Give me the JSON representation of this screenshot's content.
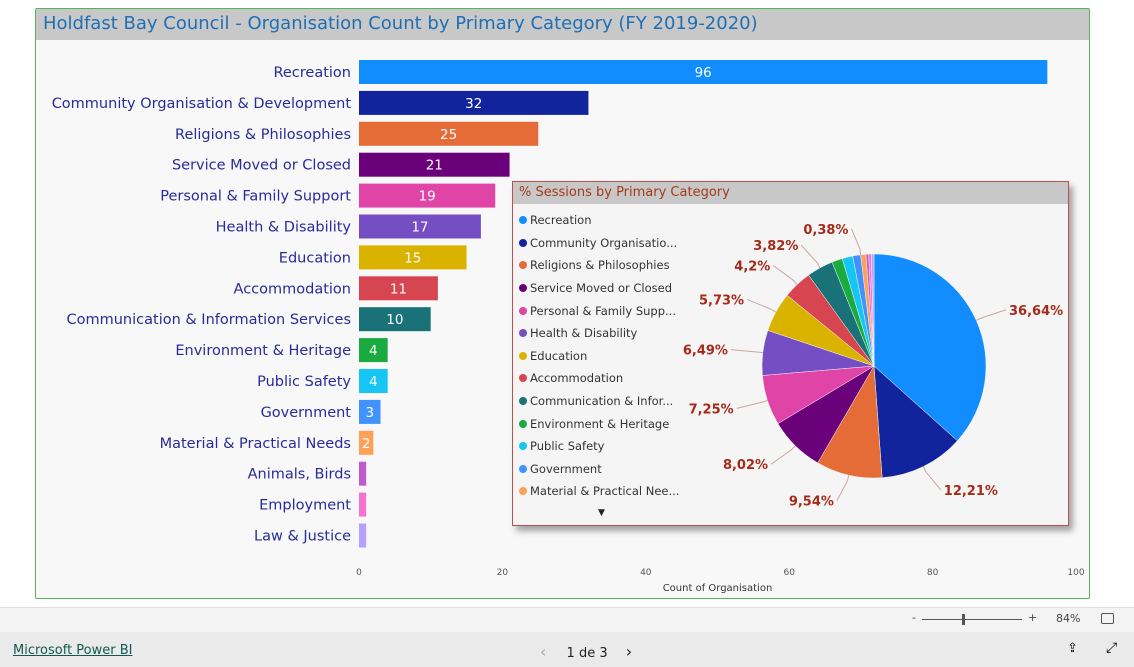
{
  "title": "Holdfast Bay Council - Organisation Count by Primary Category (FY 2019-2020)",
  "bar_chart": {
    "type": "bar",
    "orientation": "horizontal",
    "categories": [
      "Recreation",
      "Community Organisation & Development",
      "Religions & Philosophies",
      "Service Moved or Closed",
      "Personal & Family Support",
      "Health & Disability",
      "Education",
      "Accommodation",
      "Communication & Information Services",
      "Environment & Heritage",
      "Public Safety",
      "Government",
      "Material & Practical Needs",
      "Animals, Birds",
      "Employment",
      "Law & Justice"
    ],
    "values": [
      96,
      32,
      25,
      21,
      19,
      17,
      15,
      11,
      10,
      4,
      4,
      3,
      2,
      1,
      1,
      1
    ],
    "data_labels": [
      "96",
      "32",
      "25",
      "21",
      "19",
      "17",
      "15",
      "11",
      "10",
      "4",
      "4",
      "3",
      "2",
      "",
      "",
      ""
    ],
    "colors": [
      "#118DFF",
      "#12239E",
      "#E66C37",
      "#6B007B",
      "#E044A7",
      "#744EC2",
      "#D9B300",
      "#D64550",
      "#197278",
      "#1AAB40",
      "#15C6F4",
      "#4092FF",
      "#FFA058",
      "#BE5DC9",
      "#F472D0",
      "#B5A1FF"
    ],
    "xlabel": "Count of Organisation",
    "xlim": [
      0,
      100
    ],
    "xticks": [
      "0",
      "20",
      "40",
      "60",
      "80",
      "100"
    ],
    "grid": false
  },
  "chart_data": {
    "type": "pie",
    "title": "% Sessions by Primary Category",
    "categories": [
      "Recreation",
      "Community Organisation & Development",
      "Religions & Philosophies",
      "Service Moved or Closed",
      "Personal & Family Support",
      "Health & Disability",
      "Education",
      "Accommodation",
      "Communication & Information Services",
      "Environment & Heritage",
      "Public Safety",
      "Government",
      "Material & Practical Needs",
      "Animals, Birds",
      "Employment",
      "Law & Justice"
    ],
    "values": [
      36.64,
      12.21,
      9.54,
      8.02,
      7.25,
      6.49,
      5.73,
      4.2,
      3.82,
      1.53,
      1.53,
      1.15,
      0.76,
      0.38,
      0.38,
      0.38
    ],
    "data_labels": [
      "36,64%",
      "12,21%",
      "9,54%",
      "8,02%",
      "7,25%",
      "6,49%",
      "5,73%",
      "4,2%",
      "3,82%",
      "",
      "",
      "",
      "",
      "",
      "",
      "0,38%"
    ],
    "legend_items": [
      "Recreation",
      "Community Organisatio...",
      "Religions & Philosophies",
      "Service Moved or Closed",
      "Personal & Family Supp...",
      "Health & Disability",
      "Education",
      "Accommodation",
      "Communication & Infor...",
      "Environment & Heritage",
      "Public Safety",
      "Government",
      "Material & Practical Nee..."
    ],
    "legend_placement": "left"
  },
  "zoom": {
    "minus": "-",
    "plus": "+",
    "level": "84%"
  },
  "footer": {
    "brand": "Microsoft Power BI",
    "page": "1 de 3",
    "prev": "‹",
    "next": "›"
  },
  "icons": {
    "legend_more": "▼",
    "fit": "fit-page-icon",
    "share": "share-icon",
    "fullscreen": "fullscreen-icon"
  }
}
